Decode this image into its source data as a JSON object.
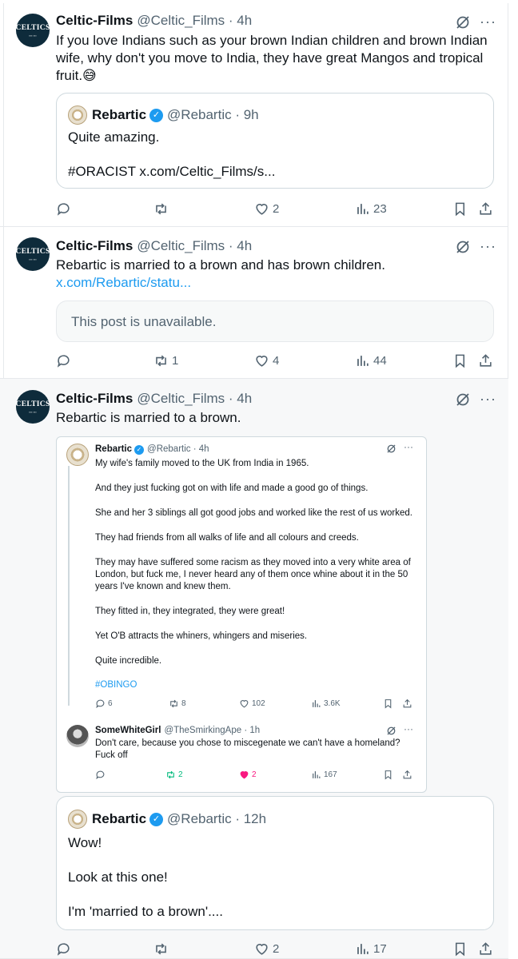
{
  "colors": {
    "accent": "#1d9bf0",
    "muted": "#536471",
    "like": "#f91880",
    "retweet": "#00ba7c",
    "border": "#cfd9de"
  },
  "posts": [
    {
      "avatar_text": "CELTICS",
      "name": "Celtic-Films",
      "handle": "@Celtic_Films · 4h",
      "text": "If you love Indians such as your brown Indian children and brown Indian wife, why don't you move to India, they have great Mangos and tropical fruit.😅",
      "quote": {
        "name": "Rebartic",
        "handle": "@Rebartic · 9h",
        "line1": "Quite amazing.",
        "line2": "#ORACIST x.com/Celtic_Films/s..."
      },
      "stats": {
        "replies": "",
        "reposts": "",
        "likes": "2",
        "views": "23"
      }
    },
    {
      "avatar_text": "CELTICS",
      "name": "Celtic-Films",
      "handle": "@Celtic_Films · 4h",
      "text": "Rebartic is married to a brown and has brown children.",
      "link": "x.com/Rebartic/statu...",
      "unavailable": "This post is unavailable.",
      "stats": {
        "replies": "",
        "reposts": "1",
        "likes": "4",
        "views": "44"
      }
    },
    {
      "avatar_text": "CELTICS",
      "name": "Celtic-Films",
      "handle": "@Celtic_Films · 4h",
      "text": "Rebartic is married to a brown.",
      "screenshot": {
        "post": {
          "name": "Rebartic",
          "handle": "@Rebartic · 4h",
          "paragraphs": [
            "My wife's family moved to the UK from India in 1965.",
            "And they just fucking got on with life and made a good go of things.",
            "She and her 3 siblings all got good jobs and worked like the rest of us worked.",
            "They had friends from all walks of life and all colours and creeds.",
            "They may have suffered some racism as they moved into a very white area of London, but fuck me, I never heard any of them once whine about it  in the 50 years I've known and knew them.",
            "They fitted in, they integrated, they were great!",
            "Yet O'B attracts the whiners, whingers and miseries.",
            "Quite incredible."
          ],
          "hashtag": "#OBINGO",
          "stats": {
            "replies": "6",
            "reposts": "8",
            "likes": "102",
            "views": "3.6K"
          }
        },
        "reply": {
          "name": "SomeWhiteGirl",
          "handle": "@TheSmirkingApe · 1h",
          "text": "Don't care, because you chose to miscegenate we can't have a homeland? Fuck off",
          "stats": {
            "replies": "",
            "reposts": "2",
            "likes": "2",
            "views": "167"
          }
        }
      },
      "quote": {
        "name": "Rebartic",
        "handle": "@Rebartic · 12h",
        "line1": "Wow!",
        "line2": "Look at  this one!",
        "line3": "I'm 'married to a brown'...."
      },
      "stats": {
        "replies": "",
        "reposts": "",
        "likes": "2",
        "views": "17"
      }
    }
  ]
}
